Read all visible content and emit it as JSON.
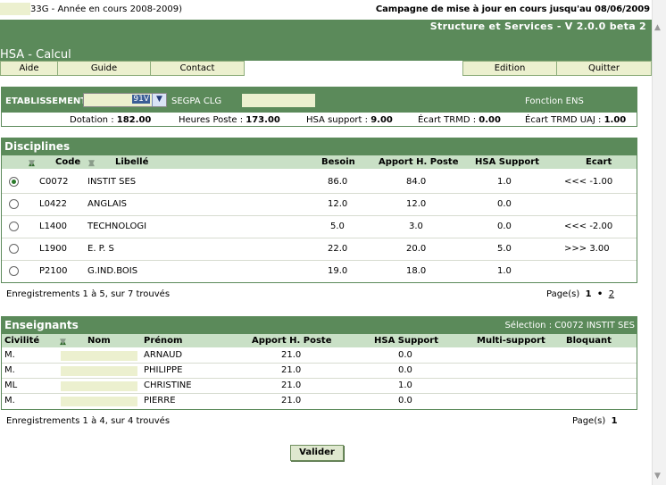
{
  "topline": {
    "year_text": "33G - Année en cours 2008-2009)",
    "campagne": "Campagne de mise à jour en cours jusqu'au 08/06/2009"
  },
  "header": {
    "version": "Structure et Services - V 2.0.0 beta 2",
    "title": "HSA - Calcul"
  },
  "menu": {
    "aide": "Aide",
    "guide": "Guide",
    "contact": "Contact",
    "edition": "Edition",
    "quitter": "Quitter"
  },
  "etablissement": {
    "label": "ETABLISSEMENT",
    "select_value": "91V",
    "segpa": "SEGPA CLG",
    "fonction": "Fonction ENS",
    "stats": {
      "dotation_label": "Dotation :",
      "dotation": "182.00",
      "heures_label": "Heures Poste :",
      "heures": "173.00",
      "hsa_label": "HSA support :",
      "hsa": "9.00",
      "ecart_label": "Écart TRMD :",
      "ecart": "0.00",
      "ecart_uaj_label": "Écart TRMD UAJ :",
      "ecart_uaj": "1.00"
    }
  },
  "disciplines": {
    "title": "Disciplines",
    "headers": {
      "code": "Code",
      "libelle": "Libellé",
      "besoin": "Besoin",
      "apport": "Apport H. Poste",
      "hsa": "HSA Support",
      "ecart": "Ecart"
    },
    "rows": [
      {
        "code": "C0072",
        "libelle": "INSTIT SES",
        "besoin": "86.0",
        "apport": "84.0",
        "hsa": "1.0",
        "ecart": "<<< -1.00",
        "selected": true
      },
      {
        "code": "L0422",
        "libelle": "ANGLAIS",
        "besoin": "12.0",
        "apport": "12.0",
        "hsa": "0.0",
        "ecart": "",
        "selected": false
      },
      {
        "code": "L1400",
        "libelle": "TECHNOLOGI",
        "besoin": "5.0",
        "apport": "3.0",
        "hsa": "0.0",
        "ecart": "<<< -2.00",
        "selected": false
      },
      {
        "code": "L1900",
        "libelle": "E. P. S",
        "besoin": "22.0",
        "apport": "20.0",
        "hsa": "5.0",
        "ecart": ">>> 3.00",
        "selected": false
      },
      {
        "code": "P2100",
        "libelle": "G.IND.BOIS",
        "besoin": "19.0",
        "apport": "18.0",
        "hsa": "1.0",
        "ecart": "",
        "selected": false
      }
    ],
    "footer": "Enregistrements 1 à 5, sur 7 trouvés",
    "pages_label": "Page(s)",
    "page_current": "1",
    "page_sep": "•",
    "page_next": "2"
  },
  "enseignants": {
    "title": "Enseignants",
    "selection": "Sélection : C0072 INSTIT SES",
    "headers": {
      "civilite": "Civilité",
      "nom": "Nom",
      "prenom": "Prénom",
      "apport": "Apport H. Poste",
      "hsa": "HSA Support",
      "multi": "Multi-support",
      "bloquant": "Bloquant"
    },
    "rows": [
      {
        "civilite": "M.",
        "prenom": "ARNAUD",
        "apport": "21.0",
        "hsa": "0.0"
      },
      {
        "civilite": "M.",
        "prenom": "PHILIPPE",
        "apport": "21.0",
        "hsa": "0.0"
      },
      {
        "civilite": "ML",
        "prenom": "CHRISTINE",
        "apport": "21.0",
        "hsa": "1.0"
      },
      {
        "civilite": "M.",
        "prenom": "PIERRE",
        "apport": "21.0",
        "hsa": "0.0"
      }
    ],
    "footer": "Enregistrements 1 à 4, sur 4 trouvés",
    "pages_label": "Page(s)",
    "page_current": "1"
  },
  "valider_label": "Valider",
  "colors": {
    "green": "#5b8a5a",
    "light_green": "#c9e0c6",
    "cream": "#ecf0cf"
  }
}
